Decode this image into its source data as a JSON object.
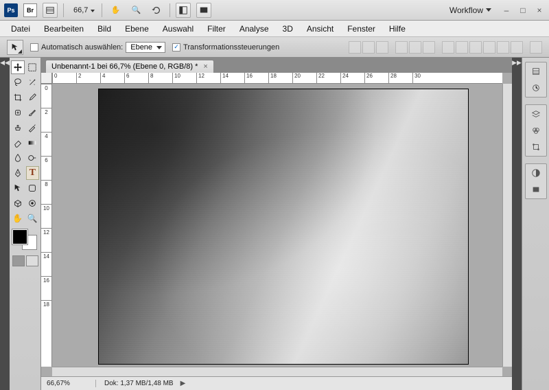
{
  "topbar": {
    "app_abbrev": "Ps",
    "bridge_abbrev": "Br",
    "zoom": "66,7",
    "workflow_label": "Workflow"
  },
  "menu": {
    "items": [
      "Datei",
      "Bearbeiten",
      "Bild",
      "Ebene",
      "Auswahl",
      "Filter",
      "Analyse",
      "3D",
      "Ansicht",
      "Fenster",
      "Hilfe"
    ]
  },
  "options": {
    "auto_select_label": "Automatisch auswählen:",
    "auto_select_value": "Ebene",
    "transform_label": "Transformationssteuerungen"
  },
  "document": {
    "tab_title": "Unbenannt-1 bei 66,7% (Ebene 0, RGB/8) *"
  },
  "ruler_h": [
    "0",
    "2",
    "4",
    "6",
    "8",
    "10",
    "12",
    "14",
    "16",
    "18",
    "20",
    "22",
    "24",
    "26",
    "28",
    "30"
  ],
  "ruler_v": [
    "0",
    "2",
    "4",
    "6",
    "8",
    "10",
    "12",
    "14",
    "16",
    "18"
  ],
  "status": {
    "zoom": "66,67%",
    "doc": "Dok: 1,37 MB/1,48 MB"
  },
  "colors": {
    "foreground": "#000000",
    "background": "#ffffff"
  }
}
